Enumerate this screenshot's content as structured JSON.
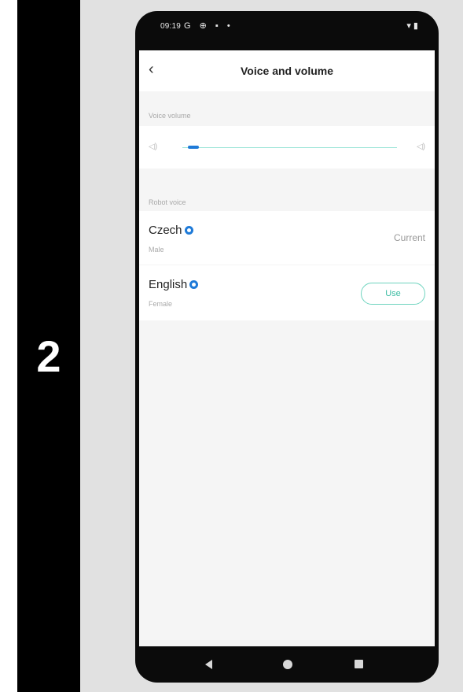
{
  "step": {
    "number": "2"
  },
  "status_bar": {
    "time": "09:19",
    "icons": "G ⊕ ▪ •",
    "right_icons": "▾ ▮"
  },
  "header": {
    "title": "Voice and volume",
    "back_icon": "‹"
  },
  "volume_section": {
    "label": "Voice volume",
    "level": 0.05
  },
  "voice_section": {
    "label": "Robot voice",
    "voices": [
      {
        "name": "Czech",
        "gender": "Male",
        "status": "Current"
      },
      {
        "name": "English",
        "gender": "Female",
        "action": "Use"
      }
    ]
  },
  "colors": {
    "accent_blue": "#1e7ad8",
    "accent_teal": "#3cbca3"
  }
}
